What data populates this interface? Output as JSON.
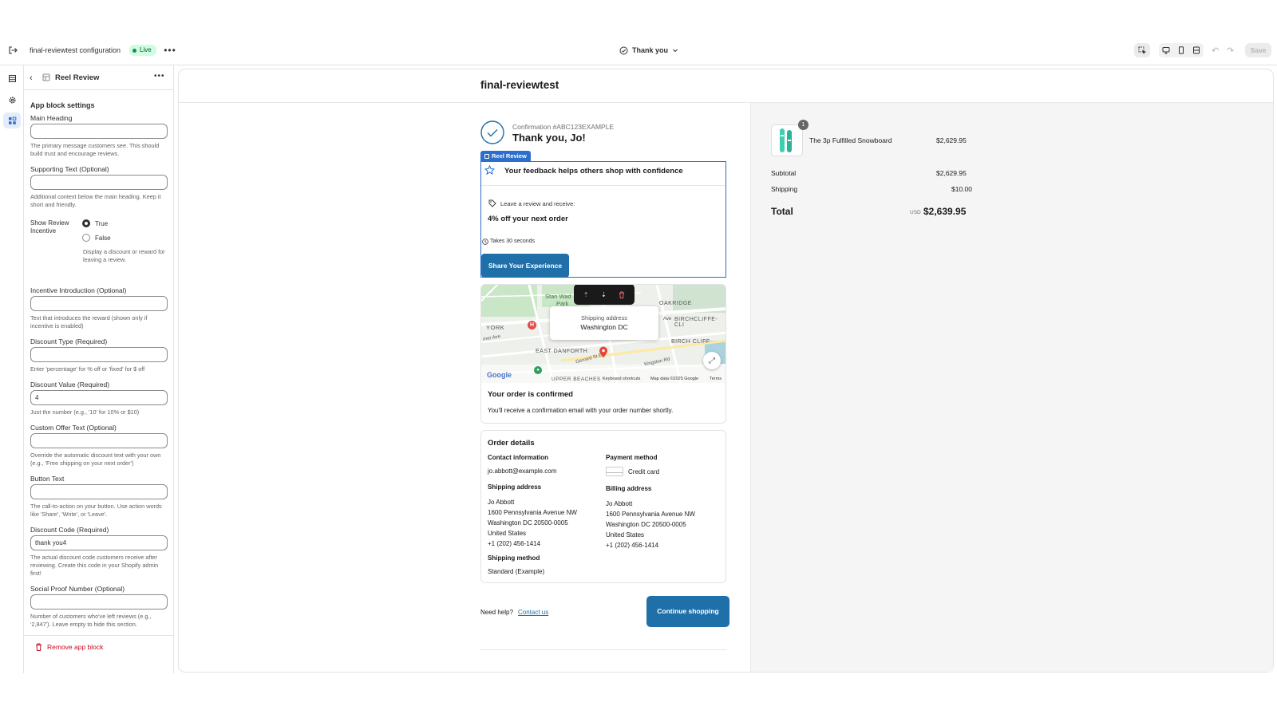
{
  "topbar": {
    "config_title": "final-reviewtest configuration",
    "live_badge": "Live",
    "page_selector": "Thank you",
    "save_label": "Save"
  },
  "sidebar": {
    "block_title": "Reel Review",
    "section_title": "App block settings",
    "main_heading_label": "Main Heading",
    "main_heading_help": "The primary message customers see. This should build trust and encourage reviews.",
    "supporting_label": "Supporting Text (Optional)",
    "supporting_help": "Additional context below the main heading. Keep it short and friendly.",
    "incentive_label": "Show Review Incentive",
    "incentive_true": "True",
    "incentive_false": "False",
    "incentive_help": "Display a discount or reward for leaving a review.",
    "intro_label": "Incentive Introduction (Optional)",
    "intro_help": "Text that introduces the reward (shown only if incentive is enabled)",
    "discount_type_label": "Discount Type (Required)",
    "discount_type_help": "Enter 'percentage' for % off or 'fixed' for $ off",
    "discount_value_label": "Discount Value (Required)",
    "discount_value": "4",
    "discount_value_help": "Just the number (e.g., '10' for 10% or $10)",
    "custom_offer_label": "Custom Offer Text (Optional)",
    "custom_offer_help": "Override the automatic discount text with your own (e.g., 'Free shipping on your next order')",
    "button_text_label": "Button Text",
    "button_text_help": "The call-to-action on your button. Use action words like 'Share', 'Write', or 'Leave'.",
    "discount_code_label": "Discount Code (Required)",
    "discount_code": "thank you4",
    "discount_code_help": "The actual discount code customers receive after reviewing. Create this code in your Shopify admin first!",
    "social_proof_label": "Social Proof Number (Optional)",
    "social_proof_help": "Number of customers who've left reviews (e.g., '2,847'). Leave empty to hide this section.",
    "remove_label": "Remove app block"
  },
  "preview": {
    "store_name": "final-reviewtest",
    "confirmation": "Confirmation #ABC123EXAMPLE",
    "thank_you": "Thank you, Jo!",
    "block_tag": "Reel Review",
    "review_heading": "Your feedback helps others shop with confidence",
    "leave_review": "Leave a review and receive:",
    "offer": "4% off your next order",
    "takes": "Takes 30 seconds",
    "share_button": "Share Your Experience",
    "map": {
      "labels": [
        "Stan Wad",
        "Park",
        "OAKRIDGE",
        "YORK",
        "BIRCHCLIFFE-CLI",
        "BIRCH CLIFF",
        "EAST DANFORTH",
        "Gerrard St E",
        "Kingston Rd",
        "UPPER BEACHES",
        "Ave",
        "rner Ave"
      ],
      "popup_title": "Shipping address",
      "popup_value": "Washington DC",
      "google": "Google",
      "keyboard": "Keyboard shortcuts",
      "mapdata": "Map data ©2025 Google",
      "terms": "Terms"
    },
    "confirmed_title": "Your order is confirmed",
    "confirmed_text": "You'll receive a confirmation email with your order number shortly.",
    "order_details": "Order details",
    "contact_label": "Contact information",
    "contact_value": "jo.abbott@example.com",
    "payment_label": "Payment method",
    "payment_value": "Credit card",
    "ship_addr_label": "Shipping address",
    "ship_addr": [
      "Jo Abbott",
      "1600 Pennsylvania Avenue NW",
      "Washington DC 20500-0005",
      "United States",
      "+1 (202) 456-1414"
    ],
    "bill_addr_label": "Billing address",
    "bill_addr": [
      "Jo Abbott",
      "1600 Pennsylvania Avenue NW",
      "Washington DC 20500-0005",
      "United States",
      "+1 (202) 456-1414"
    ],
    "ship_method_label": "Shipping method",
    "ship_method": "Standard (Example)",
    "need_help": "Need help?",
    "contact_us": "Contact us",
    "continue": "Continue shopping"
  },
  "summary": {
    "qty": "1",
    "product": "The 3p Fulfilled Snowboard",
    "product_price": "$2,629.95",
    "subtotal_label": "Subtotal",
    "subtotal": "$2,629.95",
    "shipping_label": "Shipping",
    "shipping": "$10.00",
    "total_label": "Total",
    "currency": "USD",
    "total": "$2,639.95"
  },
  "colors": {
    "accent": "#2c6ecb",
    "button": "#1f6fa8",
    "live": "#29845a",
    "danger": "#c70a24"
  }
}
